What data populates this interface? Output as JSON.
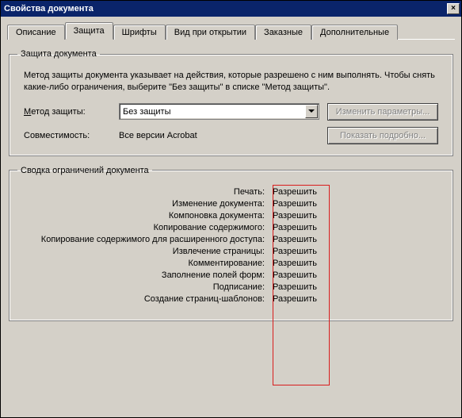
{
  "window": {
    "title": "Свойства документа"
  },
  "tabs": {
    "items": [
      {
        "label": "Описание"
      },
      {
        "label": "Защита"
      },
      {
        "label": "Шрифты"
      },
      {
        "label": "Вид при открытии"
      },
      {
        "label": "Заказные"
      },
      {
        "label": "Дополнительные"
      }
    ],
    "active_index": 1
  },
  "security_group": {
    "legend": "Защита документа",
    "description": "Метод защиты документа указывает на действия, которые разрешено с ним выполнять. Чтобы снять какие-либо ограничения, выберите \"Без защиты\" в списке \"Метод защиты\".",
    "method_label_pre": "М",
    "method_label_post": "етод защиты:",
    "method_value": "Без защиты",
    "compat_label": "Совместимость:",
    "compat_value": "Все версии Acrobat",
    "btn_change": "Изменить параметры...",
    "btn_details": "Показать подробно..."
  },
  "restrictions_group": {
    "legend": "Сводка ограничений документа",
    "rows": [
      {
        "label": "Печать:",
        "value": "Разрешить"
      },
      {
        "label": "Изменение документа:",
        "value": "Разрешить"
      },
      {
        "label": "Компоновка документа:",
        "value": "Разрешить"
      },
      {
        "label": "Копирование содержимого:",
        "value": "Разрешить"
      },
      {
        "label": "Копирование содержимого для расширенного доступа:",
        "value": "Разрешить"
      },
      {
        "label": "Извлечение страницы:",
        "value": "Разрешить"
      },
      {
        "label": "Комментирование:",
        "value": "Разрешить"
      },
      {
        "label": "Заполнение полей форм:",
        "value": "Разрешить"
      },
      {
        "label": "Подписание:",
        "value": "Разрешить"
      },
      {
        "label": "Создание страниц-шаблонов:",
        "value": "Разрешить"
      }
    ]
  }
}
